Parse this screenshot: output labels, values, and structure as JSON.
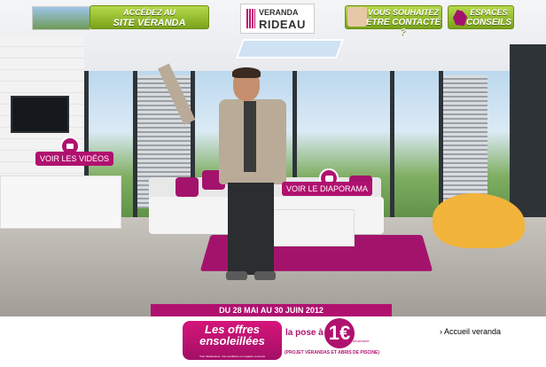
{
  "header": {
    "site_button": {
      "line1": "ACCÉDEZ AU",
      "line2": "SITE VÉRANDA"
    },
    "logo": {
      "line1": "VERANDA",
      "line2": "RIDEAU"
    },
    "contact_button": {
      "line1": "VOUS SOUHAITEZ",
      "line2": "ÊTRE CONTACTÉ ?"
    },
    "conseils_button": {
      "line1": "ESPACES",
      "line2": "CONSEILS"
    }
  },
  "scene": {
    "videos_label": "VOIR LES VIDÉOS",
    "diaporama_label": "VOIR LE DIAPORAMA"
  },
  "promo": {
    "dates": "DU 28 MAI AU 30 JUIN 2012",
    "offer_line1": "Les offres",
    "offer_line2": "ensoleillées",
    "offer_small": "*Voir distributeurs. Voir conditions en magasin concerné",
    "pose_line1": "la pose à",
    "pose_line2": "",
    "price": "1€",
    "price_suffix": "seulement",
    "projects": "(PROJET VÉRANDAS ET ABRIS DE PISCINE)"
  },
  "footer": {
    "accueil_link": "› Accueil veranda"
  },
  "colors": {
    "brand": "#b0116f",
    "green": "#8bb526"
  }
}
